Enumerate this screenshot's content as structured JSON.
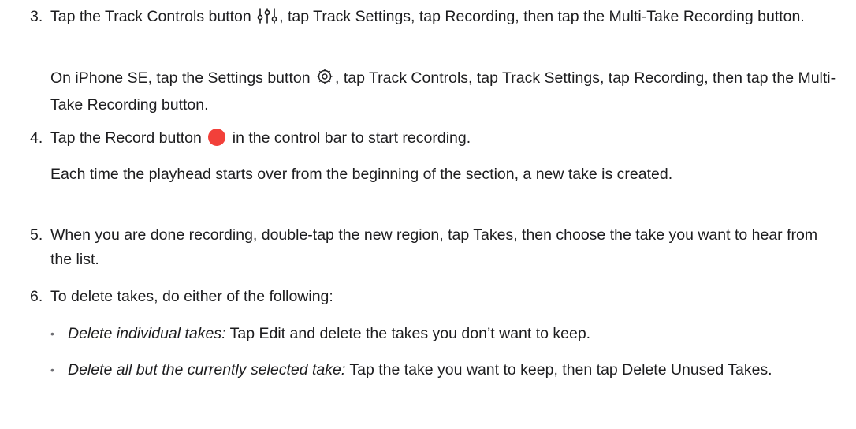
{
  "steps": [
    {
      "number": "3.",
      "text_a": "Tap the Track Controls button",
      "icon_a": "track-controls-icon",
      "text_b": ", tap Track Settings, tap Recording, then tap the Multi-Take Recording button.",
      "note_a": "On iPhone SE, tap the Settings button",
      "note_icon": "settings-gear-icon",
      "note_b": ", tap Track Controls, tap Track Settings, tap Recording, then tap the Multi-Take Recording button."
    },
    {
      "number": "4.",
      "text_a": "Tap the Record button",
      "icon_a": "record-icon",
      "text_b": "in the control bar to start recording.",
      "note": "Each time the playhead starts over from the beginning of the section, a new take is created."
    },
    {
      "number": "5.",
      "text": "When you are done recording, double-tap the new region, tap Takes, then choose the take you want to hear from the list."
    },
    {
      "number": "6.",
      "text": "To delete takes, do either of the following:",
      "bullets": [
        {
          "marker": "•",
          "term": "Delete individual takes:",
          "desc": "Tap Edit and delete the takes you don’t want to keep."
        },
        {
          "marker": "•",
          "term": "Delete all but the currently selected take:",
          "desc": "Tap the take you want to keep, then tap Delete Unused Takes."
        }
      ]
    }
  ],
  "colors": {
    "text": "#1d1d1f",
    "record": "#f2403a",
    "bullet": "#6e6e73"
  }
}
